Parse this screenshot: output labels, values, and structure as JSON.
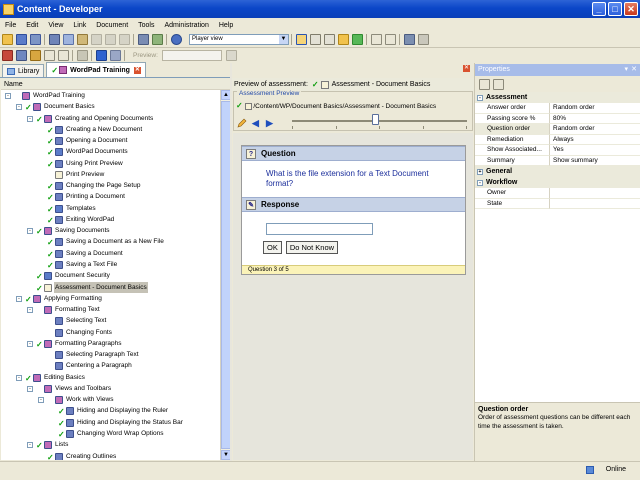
{
  "window": {
    "title": "Content - Developer"
  },
  "menu": [
    "File",
    "Edit",
    "View",
    "Link",
    "Document",
    "Tools",
    "Administration",
    "Help"
  ],
  "toolbar": {
    "view_mode": "Player view",
    "preview_label": "Preview:"
  },
  "tabs": [
    {
      "label": "Library"
    },
    {
      "label": "WordPad Training"
    }
  ],
  "tree": {
    "header": "Name",
    "items": [
      {
        "label": "WordPad Training",
        "level": 0,
        "toggle": "-",
        "check": false,
        "icon": "book-icon"
      },
      {
        "label": "Document Basics",
        "level": 1,
        "toggle": "-",
        "check": true,
        "icon": "book-icon"
      },
      {
        "label": "Creating and Opening Documents",
        "level": 2,
        "toggle": "-",
        "check": true,
        "icon": "section-icon"
      },
      {
        "label": "Creating a New Document",
        "level": 3,
        "toggle": "",
        "check": true,
        "icon": "topic-icon"
      },
      {
        "label": "Opening a Document",
        "level": 3,
        "toggle": "",
        "check": true,
        "icon": "topic-icon"
      },
      {
        "label": "WordPad Documents",
        "level": 3,
        "toggle": "",
        "check": true,
        "icon": "doc-icon"
      },
      {
        "label": "Using Print Preview",
        "level": 3,
        "toggle": "",
        "check": true,
        "icon": "topic-icon"
      },
      {
        "label": "Print Preview",
        "level": 3,
        "toggle": "",
        "check": false,
        "icon": "question-icon"
      },
      {
        "label": "Changing the Page Setup",
        "level": 3,
        "toggle": "",
        "check": true,
        "icon": "topic-icon"
      },
      {
        "label": "Printing a Document",
        "level": 3,
        "toggle": "",
        "check": true,
        "icon": "topic-icon"
      },
      {
        "label": "Templates",
        "level": 3,
        "toggle": "",
        "check": true,
        "icon": "doc-icon"
      },
      {
        "label": "Exiting WordPad",
        "level": 3,
        "toggle": "",
        "check": true,
        "icon": "topic-icon"
      },
      {
        "label": "Saving Documents",
        "level": 2,
        "toggle": "-",
        "check": true,
        "icon": "section-icon"
      },
      {
        "label": "Saving a Document as a New File",
        "level": 3,
        "toggle": "",
        "check": true,
        "icon": "topic-icon"
      },
      {
        "label": "Saving a Document",
        "level": 3,
        "toggle": "",
        "check": true,
        "icon": "topic-icon"
      },
      {
        "label": "Saving a Text File",
        "level": 3,
        "toggle": "",
        "check": true,
        "icon": "topic-icon"
      },
      {
        "label": "Document Security",
        "level": 2,
        "toggle": "",
        "check": true,
        "icon": "doc-icon"
      },
      {
        "label": "Assessment - Document Basics",
        "level": 2,
        "toggle": "",
        "check": true,
        "icon": "question-icon",
        "selected": true
      },
      {
        "label": "Applying Formatting",
        "level": 1,
        "toggle": "-",
        "check": true,
        "icon": "book-icon"
      },
      {
        "label": "Formatting Text",
        "level": 2,
        "toggle": "-",
        "check": false,
        "icon": "section-icon"
      },
      {
        "label": "Selecting Text",
        "level": 3,
        "toggle": "",
        "check": false,
        "icon": "topic-icon"
      },
      {
        "label": "Changing Fonts",
        "level": 3,
        "toggle": "",
        "check": false,
        "icon": "topic-icon"
      },
      {
        "label": "Formatting Paragraphs",
        "level": 2,
        "toggle": "-",
        "check": true,
        "icon": "section-icon"
      },
      {
        "label": "Selecting Paragraph Text",
        "level": 3,
        "toggle": "",
        "check": false,
        "icon": "topic-icon"
      },
      {
        "label": "Centering a Paragraph",
        "level": 3,
        "toggle": "",
        "check": false,
        "icon": "topic-icon"
      },
      {
        "label": "Editing Basics",
        "level": 1,
        "toggle": "-",
        "check": true,
        "icon": "book-icon"
      },
      {
        "label": "Views and Toolbars",
        "level": 2,
        "toggle": "-",
        "check": false,
        "icon": "section-icon"
      },
      {
        "label": "Work with Views",
        "level": 3,
        "toggle": "-",
        "check": false,
        "icon": "section-icon"
      },
      {
        "label": "Hiding and Displaying the Ruler",
        "level": 4,
        "toggle": "",
        "check": true,
        "icon": "topic-icon"
      },
      {
        "label": "Hiding and Displaying the Status Bar",
        "level": 4,
        "toggle": "",
        "check": true,
        "icon": "topic-icon"
      },
      {
        "label": "Changing Word Wrap Options",
        "level": 4,
        "toggle": "",
        "check": true,
        "icon": "topic-icon"
      },
      {
        "label": "Lists",
        "level": 2,
        "toggle": "-",
        "check": true,
        "icon": "section-icon"
      },
      {
        "label": "Creating Outlines",
        "level": 3,
        "toggle": "",
        "check": true,
        "icon": "topic-icon"
      }
    ]
  },
  "preview": {
    "header_label": "Preview of assessment:",
    "header_name": "Assessment - Document Basics",
    "group_label": "Assessment Preview",
    "path": "/Content/WP/Document Basics/Assessment - Document Basics"
  },
  "question": {
    "section_label": "Question",
    "text": "What is the file extension for a Text Document format?",
    "response_label": "Response",
    "ok_label": "OK",
    "dont_know_label": "Do Not Know",
    "footer": "Question 3 of 5"
  },
  "properties": {
    "title": "Properties",
    "categories": [
      {
        "name": "Assessment",
        "toggle": "-",
        "rows": [
          {
            "name": "Answer order",
            "value": "Random order"
          },
          {
            "name": "Passing score %",
            "value": "80%"
          },
          {
            "name": "Question order",
            "value": "Random order",
            "selected": true
          },
          {
            "name": "Remediation",
            "value": "Always"
          },
          {
            "name": "Show Associated...",
            "value": "Yes"
          },
          {
            "name": "Summary",
            "value": "Show summary"
          }
        ]
      },
      {
        "name": "General",
        "toggle": "+",
        "rows": []
      },
      {
        "name": "Workflow",
        "toggle": "-",
        "rows": [
          {
            "name": "Owner",
            "value": ""
          },
          {
            "name": "State",
            "value": ""
          }
        ]
      }
    ],
    "description_title": "Question order",
    "description_text": "Order of assessment questions can be different each time the assessment is taken."
  },
  "status": {
    "text": "Online"
  },
  "colors": {
    "title_bar": "#0b46c8",
    "check_green": "#0e9e0e",
    "question_text": "#1c2f9c",
    "selected_row": "#c5c2b6"
  }
}
